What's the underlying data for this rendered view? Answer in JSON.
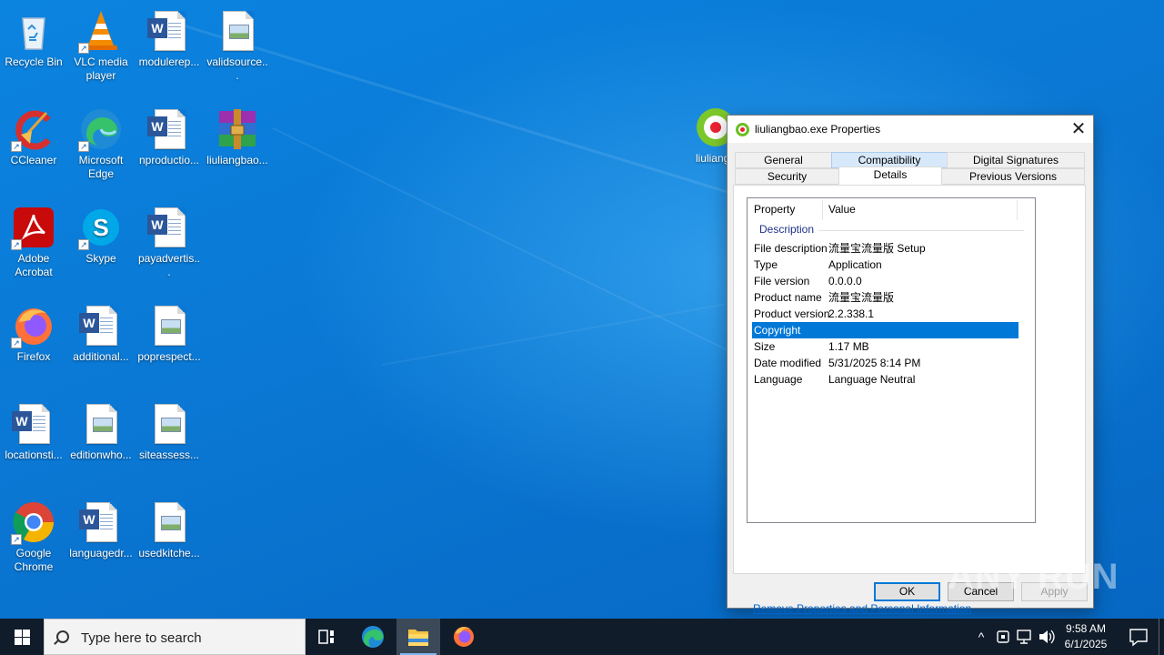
{
  "desktop": {
    "icons": [
      {
        "label": "Recycle Bin"
      },
      {
        "label": "VLC media player"
      },
      {
        "label": "modulerep..."
      },
      {
        "label": "validsource..."
      },
      {
        "label": "CCleaner"
      },
      {
        "label": "Microsoft Edge"
      },
      {
        "label": "nproductio..."
      },
      {
        "label": "liuliangbao..."
      },
      {
        "label": "Adobe Acrobat"
      },
      {
        "label": "Skype"
      },
      {
        "label": "payadvertis..."
      },
      {
        "label": "Firefox"
      },
      {
        "label": "additional..."
      },
      {
        "label": "poprespect..."
      },
      {
        "label": "locationsti..."
      },
      {
        "label": "editionwho..."
      },
      {
        "label": "siteassess..."
      },
      {
        "label": "Google Chrome"
      },
      {
        "label": "languagedr..."
      },
      {
        "label": "usedkitche..."
      },
      {
        "label": "liuliangb"
      }
    ]
  },
  "dialog": {
    "title": "liuliangbao.exe Properties",
    "tabs_row1": [
      "General",
      "Compatibility",
      "Digital Signatures"
    ],
    "tabs_row2": [
      "Security",
      "Details",
      "Previous Versions"
    ],
    "active_tab": "Details",
    "columns": [
      "Property",
      "Value"
    ],
    "group": "Description",
    "rows": [
      {
        "property": "File description",
        "value": "流量宝流量版 Setup"
      },
      {
        "property": "Type",
        "value": "Application"
      },
      {
        "property": "File version",
        "value": "0.0.0.0"
      },
      {
        "property": "Product name",
        "value": "流量宝流量版"
      },
      {
        "property": "Product version",
        "value": "2.2.338.1"
      },
      {
        "property": "Copyright",
        "value": ""
      },
      {
        "property": "Size",
        "value": "1.17 MB"
      },
      {
        "property": "Date modified",
        "value": "5/31/2025 8:14 PM"
      },
      {
        "property": "Language",
        "value": "Language Neutral"
      }
    ],
    "selected_row": "Copyright",
    "remove_link": "Remove Properties and Personal Information",
    "buttons": {
      "ok": "OK",
      "cancel": "Cancel",
      "apply": "Apply"
    }
  },
  "taskbar": {
    "search_placeholder": "Type here to search",
    "time": "9:58 AM",
    "date": "6/1/2025"
  },
  "watermark": "ANY RUN",
  "colors": {
    "desktop": "#0a78d4",
    "taskbar": "#101c2a",
    "selection": "#0078d7",
    "link": "#0066cc"
  }
}
